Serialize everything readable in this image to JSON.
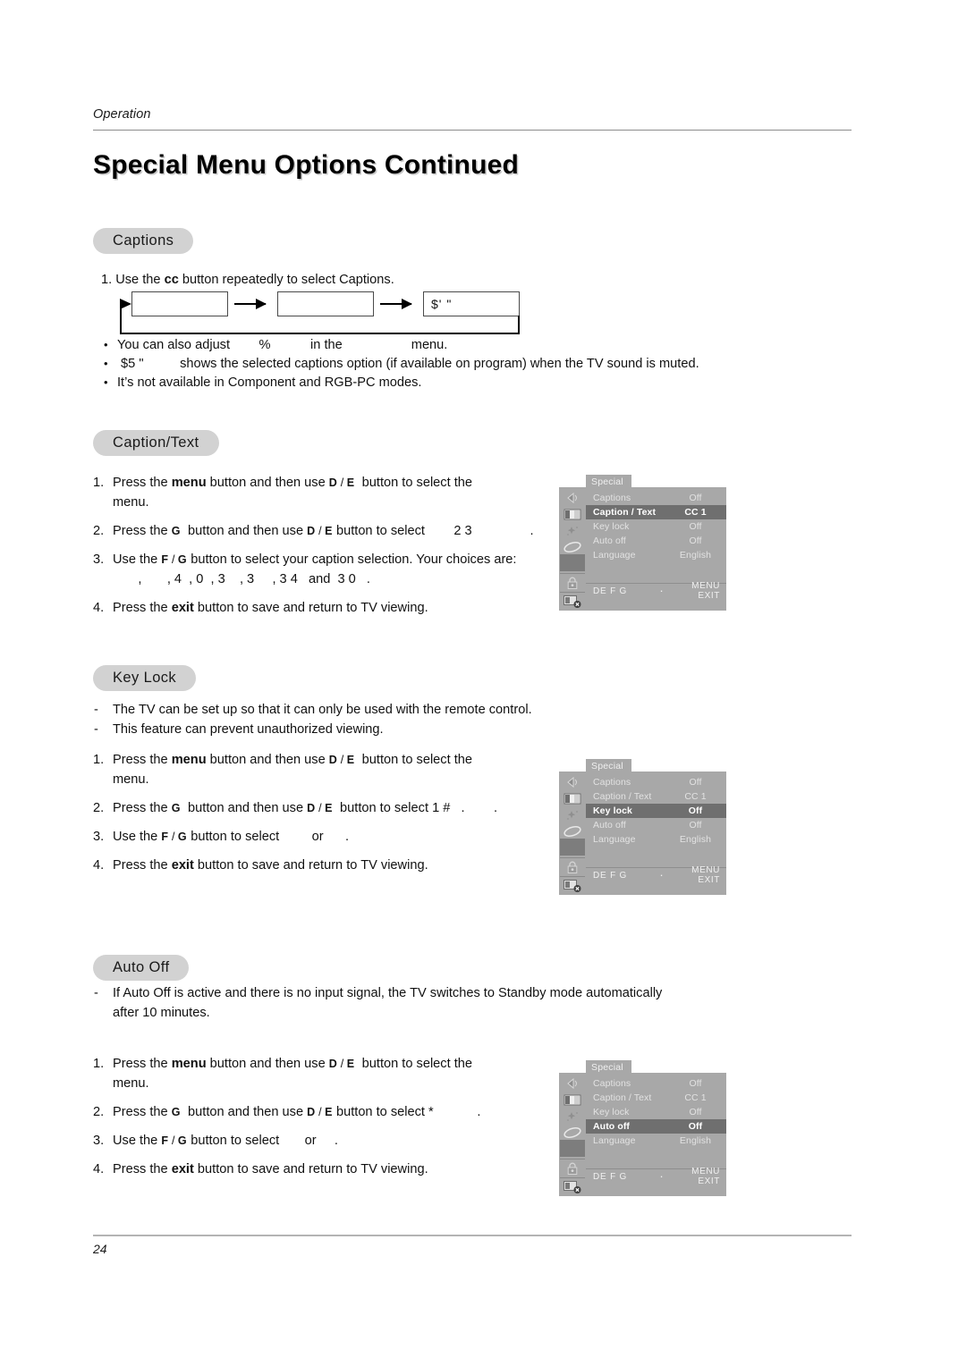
{
  "header": {
    "running_head": "Operation",
    "title": "Special Menu Options Continued"
  },
  "footer": {
    "page_number": "24"
  },
  "sections": {
    "captions": {
      "pill_label": "Captions",
      "step1": "1. Use the ",
      "step1_bold": "cc",
      "step1_rest": " button repeatedly to select Captions.",
      "flow": {
        "box1": "",
        "box2": "",
        "box3": "$' \""
      },
      "bullets": [
        {
          "marker": "•",
          "text": "You can also adjust        %           in the                   menu."
        },
        {
          "marker": "•",
          "text": " $5 \"          shows the selected captions option (if available on program) when the TV sound is muted."
        },
        {
          "marker": "•",
          "text": "It’s not available in Component and RGB-PC modes."
        }
      ]
    },
    "caption_text": {
      "pill_label": "Caption/Text",
      "steps": [
        {
          "n": "1.",
          "pre": "Press the ",
          "bold": "menu",
          "mid": " button and then use ",
          "glyph": "D",
          "slash": " / ",
          "glyph2": "E",
          "post": "  button to select the\nmenu."
        },
        {
          "n": "2.",
          "pre": "Press the ",
          "bold": "G",
          "mid": "  button and then use ",
          "glyph": "D",
          "slash": " / ",
          "glyph2": "E",
          "post": " button to select        2 3                ."
        },
        {
          "n": "3.",
          "pre": "Use the ",
          "bold": "F",
          "mid": " / ",
          "glyph": "G",
          "slash": "",
          "glyph2": "",
          "post": " button to select your caption selection. Your choices are:\n       ,       , 4  , 0  , 3    , 3     , 3 4   and  3 0   ."
        },
        {
          "n": "4.",
          "pre": "Press the ",
          "bold": "exit",
          "mid": " button to save and return to TV viewing.",
          "glyph": "",
          "slash": "",
          "glyph2": "",
          "post": ""
        }
      ]
    },
    "key_lock": {
      "pill_label": "Key Lock",
      "dashes": [
        "The TV can be set up so that it can only be used with the remote control.",
        "This feature can prevent unauthorized viewing."
      ],
      "steps": [
        {
          "n": "1.",
          "pre": "Press the ",
          "bold": "menu",
          "mid": " button and then use ",
          "glyph": "D",
          "slash": " / ",
          "glyph2": "E",
          "post": "  button to select the\nmenu."
        },
        {
          "n": "2.",
          "pre": "Press the ",
          "bold": "G",
          "mid": "  button and then use ",
          "glyph": "D",
          "slash": " / ",
          "glyph2": "E",
          "post": "  button to select 1 #   .        ."
        },
        {
          "n": "3.",
          "pre": "Use the ",
          "bold": "F",
          "mid": " / ",
          "glyph": "G",
          "slash": "",
          "glyph2": "",
          "post": " button to select         or      ."
        },
        {
          "n": "4.",
          "pre": "Press the ",
          "bold": "exit",
          "mid": " button to save and return to TV viewing.",
          "glyph": "",
          "slash": "",
          "glyph2": "",
          "post": ""
        }
      ]
    },
    "auto_off": {
      "pill_label": "Auto Off",
      "dashes": [
        "If Auto Off is active and there is no input signal, the TV switches to Standby mode automatically\nafter 10 minutes."
      ],
      "steps": [
        {
          "n": "1.",
          "pre": "Press the ",
          "bold": "menu",
          "mid": " button and then use ",
          "glyph": "D",
          "slash": " / ",
          "glyph2": "E",
          "post": "  button to select the\nmenu."
        },
        {
          "n": "2.",
          "pre": "Press the ",
          "bold": "G",
          "mid": "  button and then use ",
          "glyph": "D",
          "slash": " / ",
          "glyph2": "E",
          "post": " button to select *            ."
        },
        {
          "n": "3.",
          "pre": "Use the ",
          "bold": "F",
          "mid": " / ",
          "glyph": "G",
          "slash": "",
          "glyph2": "",
          "post": " button to select       or     ."
        },
        {
          "n": "4.",
          "pre": "Press the ",
          "bold": "exit",
          "mid": " button to save and return to TV viewing.",
          "glyph": "",
          "slash": "",
          "glyph2": "",
          "post": ""
        }
      ]
    }
  },
  "osd": {
    "tab_label": "Special",
    "footer": {
      "directions": "DE F G",
      "dot": "·",
      "menu_exit": "MENU  EXIT"
    },
    "rows": [
      {
        "label": "Captions",
        "value": "Off"
      },
      {
        "label": "Caption / Text",
        "value": "CC 1"
      },
      {
        "label": "Key lock",
        "value": "Off"
      },
      {
        "label": "Auto off",
        "value": "Off"
      },
      {
        "label": "Language",
        "value": "English"
      }
    ],
    "sidebar_icons": [
      "speaker-icon",
      "picture-contrast-icon",
      "sparkle-icon",
      "ellipse-clock-icon",
      "special-selected-icon",
      "lock-icon",
      "tv-off-icon"
    ],
    "instances": [
      {
        "name": "osd-caption-text",
        "highlight_index": 1
      },
      {
        "name": "osd-key-lock",
        "highlight_index": 2
      },
      {
        "name": "osd-auto-off",
        "highlight_index": 3
      }
    ],
    "colors": {
      "panel_bg": "#a8a8a8",
      "highlight_bg": "#6f6f6f",
      "text": "#e2e2e2",
      "highlight_text": "#ffffff"
    }
  }
}
